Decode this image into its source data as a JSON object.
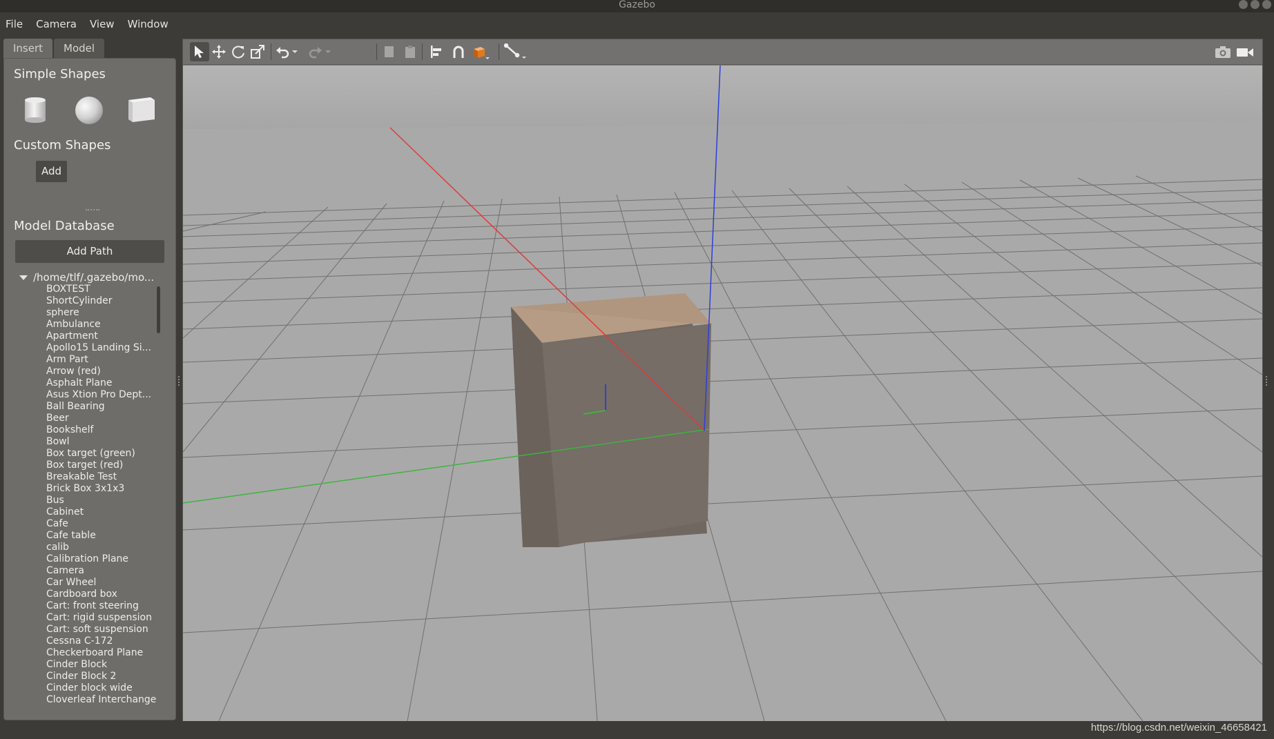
{
  "window": {
    "title": "Gazebo"
  },
  "menu": [
    "File",
    "Camera",
    "View",
    "Window"
  ],
  "tabs": [
    "Insert",
    "Model"
  ],
  "insert": {
    "simple_shapes_title": "Simple Shapes",
    "shapes": [
      "cylinder-icon",
      "sphere-icon",
      "box-icon"
    ],
    "custom_shapes_title": "Custom Shapes",
    "add_label": "Add",
    "model_db_title": "Model Database",
    "add_path_label": "Add Path",
    "root_path": "/home/tlf/.gazebo/mo...",
    "models": [
      "BOXTEST",
      "ShortCylinder",
      "sphere",
      "Ambulance",
      "Apartment",
      "Apollo15 Landing Si...",
      "Arm Part",
      "Arrow (red)",
      "Asphalt Plane",
      "Asus Xtion Pro Dept...",
      "Ball Bearing",
      "Beer",
      "Bookshelf",
      "Bowl",
      "Box target (green)",
      "Box target (red)",
      "Breakable Test",
      "Brick Box 3x1x3",
      "Bus",
      "Cabinet",
      "Cafe",
      "Cafe table",
      "calib",
      "Calibration Plane",
      "Camera",
      "Car Wheel",
      "Cardboard box",
      "Cart: front steering",
      "Cart: rigid suspension",
      "Cart: soft suspension",
      "Cessna C-172",
      "Checkerboard Plane",
      "Cinder Block",
      "Cinder Block 2",
      "Cinder block wide",
      "Cloverleaf Interchange"
    ]
  },
  "toolbar": {
    "tools": [
      "select-arrow-icon",
      "translate-icon",
      "rotate-icon",
      "scale-icon",
      "undo-icon",
      "undo-history-icon",
      "redo-icon",
      "redo-history-icon",
      "copy-icon",
      "paste-icon",
      "align-icon",
      "snap-icon",
      "view-angle-icon",
      "measure-icon",
      "screenshot-icon",
      "record-video-icon"
    ]
  },
  "colors": {
    "accent_orange": "#e07a1f",
    "x_axis": "#e03a3a",
    "y_axis": "#3fb33f",
    "z_axis": "#2f3fd8"
  },
  "watermark": "https://blog.csdn.net/weixin_46658421"
}
